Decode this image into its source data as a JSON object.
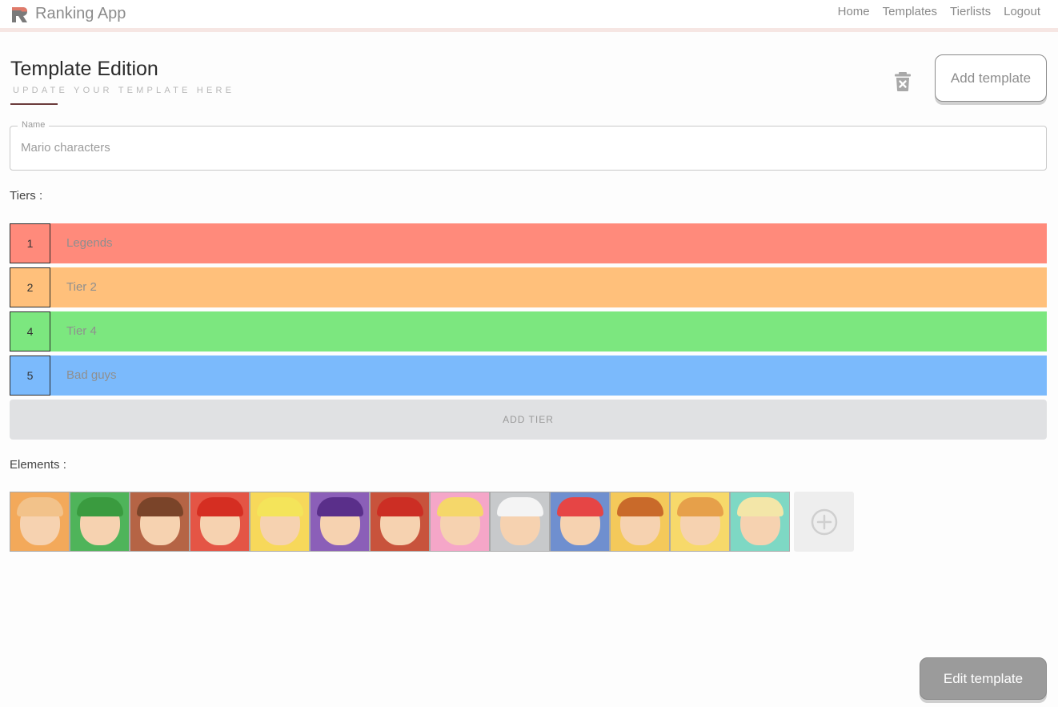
{
  "nav": {
    "brand": "Ranking App",
    "links": [
      "Home",
      "Templates",
      "Tierlists",
      "Logout"
    ]
  },
  "header": {
    "title": "Template Edition",
    "subtitle": "UPDATE YOUR TEMPLATE HERE",
    "delete_icon": "trash-icon",
    "add_template_label": "Add template"
  },
  "form": {
    "name_label": "Name",
    "name_value": "Mario characters"
  },
  "tiers_label": "Tiers :",
  "tiers": [
    {
      "number": "1",
      "label": "Legends",
      "color": "#ff8a7b"
    },
    {
      "number": "2",
      "label": "Tier 2",
      "color": "#ffc07b"
    },
    {
      "number": "4",
      "label": "Tier 4",
      "color": "#7ce77f"
    },
    {
      "number": "5",
      "label": "Bad guys",
      "color": "#7bbafc"
    }
  ],
  "add_tier_label": "ADD TIER",
  "elements_label": "Elements :",
  "elements": [
    {
      "name": "daisy",
      "bg": "#f3a95a",
      "accent": "#f2c28a"
    },
    {
      "name": "luigi",
      "bg": "#4fb45a",
      "accent": "#3a9b3f"
    },
    {
      "name": "donkey-kong",
      "bg": "#b56445",
      "accent": "#7a4429"
    },
    {
      "name": "mario",
      "bg": "#e45545",
      "accent": "#d52e22"
    },
    {
      "name": "wario",
      "bg": "#f7d85a",
      "accent": "#f4e45a"
    },
    {
      "name": "waluigi",
      "bg": "#8b5fb8",
      "accent": "#5a2f8a"
    },
    {
      "name": "diddy-kong",
      "bg": "#c8533c",
      "accent": "#cc2e24"
    },
    {
      "name": "peach",
      "bg": "#f5a6c8",
      "accent": "#f5d76a"
    },
    {
      "name": "boo",
      "bg": "#c7c9cb",
      "accent": "#f4f4f4"
    },
    {
      "name": "toad",
      "bg": "#6f8fcf",
      "accent": "#e64545"
    },
    {
      "name": "bowser",
      "bg": "#f4c95a",
      "accent": "#c96a2a"
    },
    {
      "name": "bowser-jr",
      "bg": "#f7d96a",
      "accent": "#e6a04a"
    },
    {
      "name": "rosalina",
      "bg": "#7ed8c4",
      "accent": "#f3e6a8"
    }
  ],
  "add_element_icon": "plus-circle-icon",
  "edit_template_label": "Edit template"
}
